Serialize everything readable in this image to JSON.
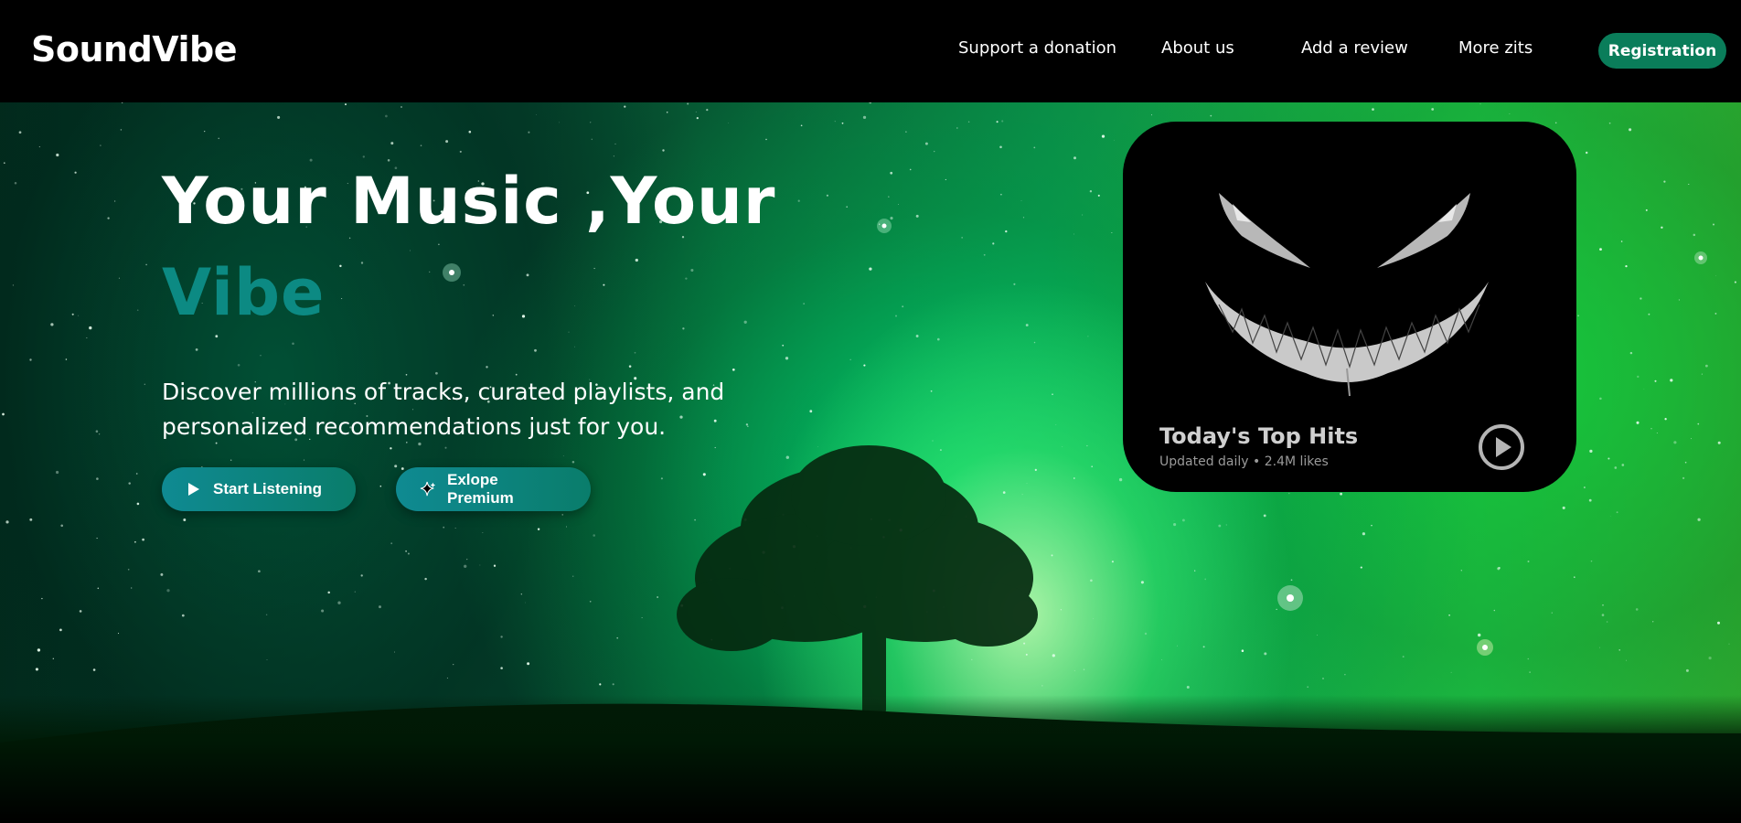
{
  "header": {
    "logo": "SoundVibe",
    "nav": [
      {
        "label": "Support a donation"
      },
      {
        "label": "About us"
      },
      {
        "label": "Add a review"
      },
      {
        "label": "More zits"
      }
    ],
    "register_label": "Registration"
  },
  "hero": {
    "title_line1": "Your Music ,Your",
    "title_line2": "Vibe",
    "description": "Discover millions of tracks, curated playlists, and personalized recommendations just for you.",
    "buttons": {
      "start_label": "Start Listening",
      "premium_label": "Exlope Premium"
    }
  },
  "card": {
    "title": "Today's Top Hits",
    "subtitle": "Updated daily • 2.4M likes",
    "art_icon": "grinning-face-art",
    "play_icon": "play-circle-icon"
  },
  "colors": {
    "accent_teal": "#0c8a83",
    "register_green": "#0a7d5a",
    "button_teal": "#0f8a92"
  }
}
